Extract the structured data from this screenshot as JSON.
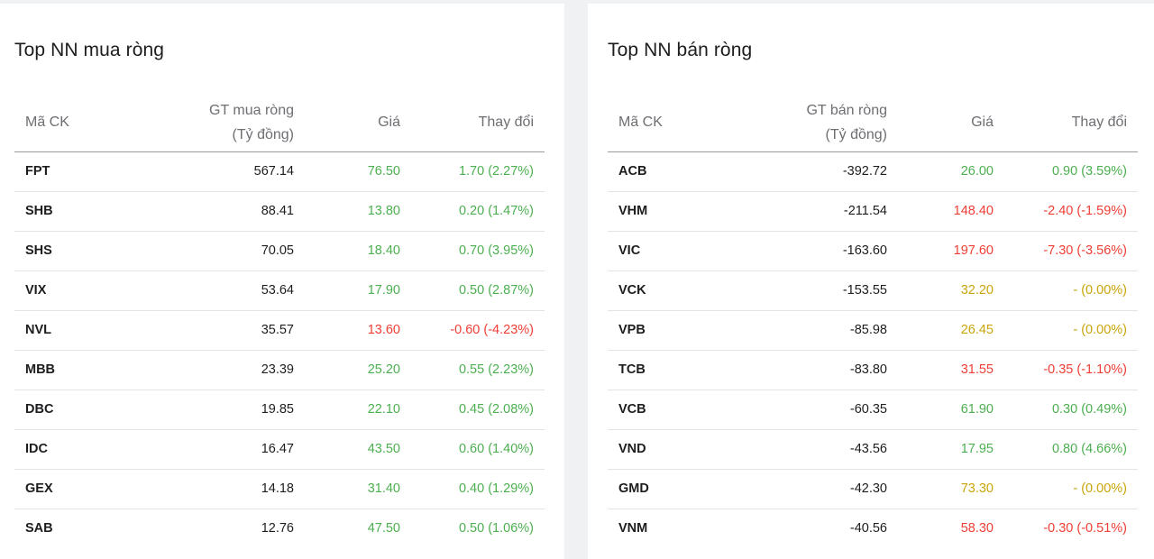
{
  "colors": {
    "up": "#4caf50",
    "down": "#ef3e36",
    "reference": "#c9a50b"
  },
  "buy_panel": {
    "title": "Top NN mua ròng",
    "headers": {
      "code": "Mã CK",
      "value_line1": "GT mua ròng",
      "value_line2": "(Tỷ đồng)",
      "price": "Giá",
      "change": "Thay đổi"
    },
    "rows": [
      {
        "code": "FPT",
        "value": "567.14",
        "price": "76.50",
        "change": "1.70 (2.27%)",
        "trend": "up"
      },
      {
        "code": "SHB",
        "value": "88.41",
        "price": "13.80",
        "change": "0.20 (1.47%)",
        "trend": "up"
      },
      {
        "code": "SHS",
        "value": "70.05",
        "price": "18.40",
        "change": "0.70 (3.95%)",
        "trend": "up"
      },
      {
        "code": "VIX",
        "value": "53.64",
        "price": "17.90",
        "change": "0.50 (2.87%)",
        "trend": "up"
      },
      {
        "code": "NVL",
        "value": "35.57",
        "price": "13.60",
        "change": "-0.60 (-4.23%)",
        "trend": "down"
      },
      {
        "code": "MBB",
        "value": "23.39",
        "price": "25.20",
        "change": "0.55 (2.23%)",
        "trend": "up"
      },
      {
        "code": "DBC",
        "value": "19.85",
        "price": "22.10",
        "change": "0.45 (2.08%)",
        "trend": "up"
      },
      {
        "code": "IDC",
        "value": "16.47",
        "price": "43.50",
        "change": "0.60 (1.40%)",
        "trend": "up"
      },
      {
        "code": "GEX",
        "value": "14.18",
        "price": "31.40",
        "change": "0.40 (1.29%)",
        "trend": "up"
      },
      {
        "code": "SAB",
        "value": "12.76",
        "price": "47.50",
        "change": "0.50 (1.06%)",
        "trend": "up"
      }
    ]
  },
  "sell_panel": {
    "title": "Top NN bán ròng",
    "headers": {
      "code": "Mã CK",
      "value_line1": "GT bán ròng",
      "value_line2": "(Tỷ đồng)",
      "price": "Giá",
      "change": "Thay đổi"
    },
    "rows": [
      {
        "code": "ACB",
        "value": "-392.72",
        "price": "26.00",
        "change": "0.90 (3.59%)",
        "trend": "up"
      },
      {
        "code": "VHM",
        "value": "-211.54",
        "price": "148.40",
        "change": "-2.40 (-1.59%)",
        "trend": "down"
      },
      {
        "code": "VIC",
        "value": "-163.60",
        "price": "197.60",
        "change": "-7.30 (-3.56%)",
        "trend": "down"
      },
      {
        "code": "VCK",
        "value": "-153.55",
        "price": "32.20",
        "change": "- (0.00%)",
        "trend": "ref"
      },
      {
        "code": "VPB",
        "value": "-85.98",
        "price": "26.45",
        "change": "- (0.00%)",
        "trend": "ref"
      },
      {
        "code": "TCB",
        "value": "-83.80",
        "price": "31.55",
        "change": "-0.35 (-1.10%)",
        "trend": "down"
      },
      {
        "code": "VCB",
        "value": "-60.35",
        "price": "61.90",
        "change": "0.30 (0.49%)",
        "trend": "up"
      },
      {
        "code": "VND",
        "value": "-43.56",
        "price": "17.95",
        "change": "0.80 (4.66%)",
        "trend": "up"
      },
      {
        "code": "GMD",
        "value": "-42.30",
        "price": "73.30",
        "change": "- (0.00%)",
        "trend": "ref"
      },
      {
        "code": "VNM",
        "value": "-40.56",
        "price": "58.30",
        "change": "-0.30 (-0.51%)",
        "trend": "down"
      }
    ]
  }
}
